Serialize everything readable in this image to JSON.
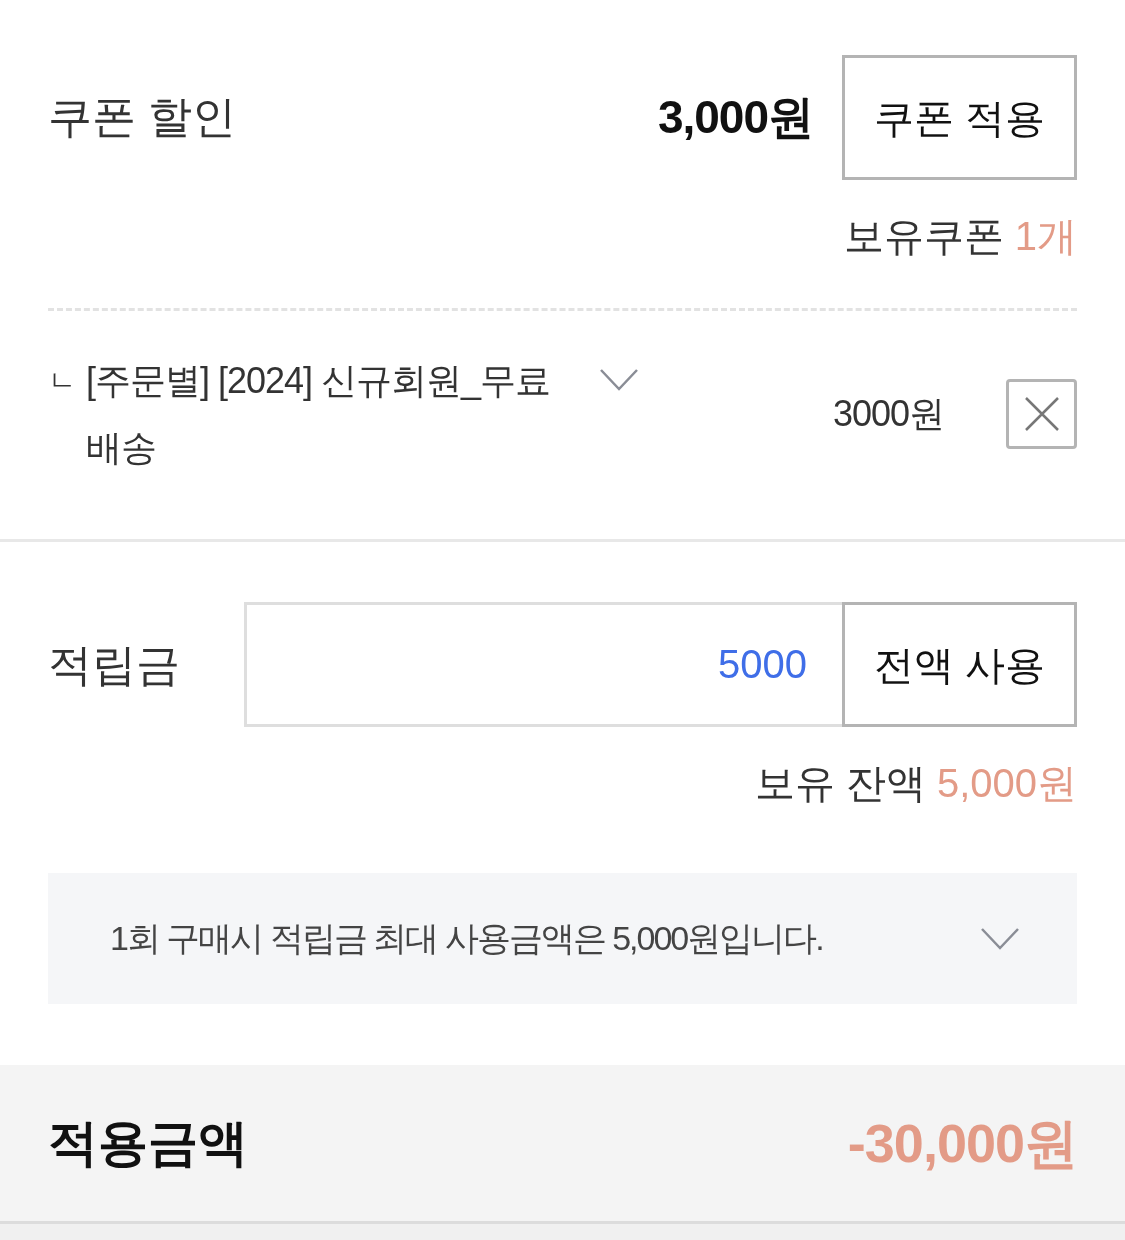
{
  "coupon_discount": {
    "label": "쿠폰 할인",
    "amount": "3,000원",
    "apply_button": "쿠폰 적용",
    "owned_label": "보유쿠폰",
    "owned_count": "1개"
  },
  "applied_coupons": [
    {
      "marker": "ㄴ",
      "name": "[주문별] [2024] 신규회원_무료 배송",
      "expanded": false,
      "amount": "3000원"
    }
  ],
  "points": {
    "label": "적립금",
    "value": "5000",
    "use_all_button": "전액 사용",
    "balance_label": "보유 잔액",
    "balance": "5,000원"
  },
  "notice": {
    "text": "1회 구매시 적립금 최대 사용금액은 5,000원입니다.",
    "expanded": false
  },
  "total": {
    "label": "적용금액",
    "amount": "-30,000원"
  }
}
